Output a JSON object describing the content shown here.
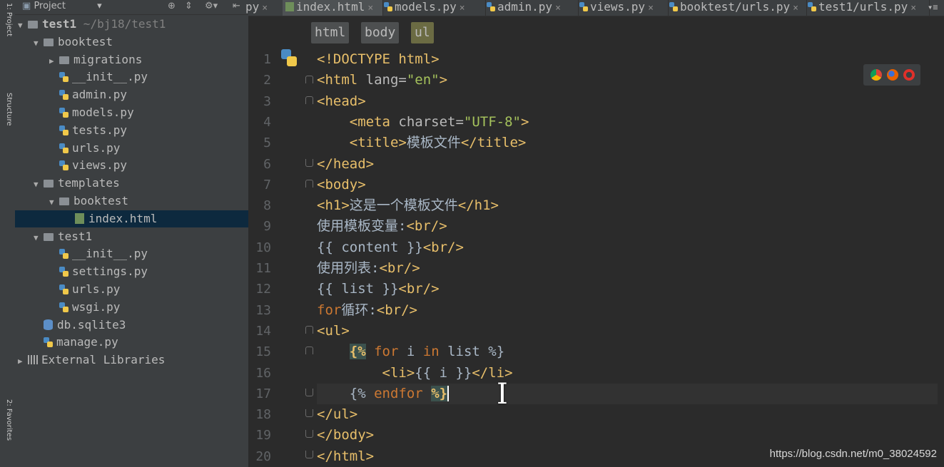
{
  "toolstrip": {
    "top_label": "1: Project",
    "mid_label": "Structure",
    "bottom_label": "2: Favorites"
  },
  "project_panel": {
    "title": "Project",
    "tree": [
      {
        "label": "test1",
        "extra": " ~/bj18/test1",
        "type": "root",
        "depth": 0,
        "arrow": "▼"
      },
      {
        "label": "booktest",
        "type": "folder",
        "depth": 1,
        "arrow": "▼"
      },
      {
        "label": "migrations",
        "type": "folder",
        "depth": 2,
        "arrow": "▶"
      },
      {
        "label": "__init__.py",
        "type": "py",
        "depth": 2
      },
      {
        "label": "admin.py",
        "type": "py",
        "depth": 2
      },
      {
        "label": "models.py",
        "type": "py",
        "depth": 2
      },
      {
        "label": "tests.py",
        "type": "py",
        "depth": 2
      },
      {
        "label": "urls.py",
        "type": "py",
        "depth": 2
      },
      {
        "label": "views.py",
        "type": "py",
        "depth": 2
      },
      {
        "label": "templates",
        "type": "folder",
        "depth": 1,
        "arrow": "▼"
      },
      {
        "label": "booktest",
        "type": "folder",
        "depth": 2,
        "arrow": "▼"
      },
      {
        "label": "index.html",
        "type": "html",
        "depth": 3,
        "selected": true
      },
      {
        "label": "test1",
        "type": "folder",
        "depth": 1,
        "arrow": "▼"
      },
      {
        "label": "__init__.py",
        "type": "py",
        "depth": 2
      },
      {
        "label": "settings.py",
        "type": "py",
        "depth": 2
      },
      {
        "label": "urls.py",
        "type": "py",
        "depth": 2
      },
      {
        "label": "wsgi.py",
        "type": "py",
        "depth": 2
      },
      {
        "label": "db.sqlite3",
        "type": "db",
        "depth": 1
      },
      {
        "label": "manage.py",
        "type": "py",
        "depth": 1
      },
      {
        "label": "External Libraries",
        "type": "lib",
        "depth": 0,
        "arrow": "▶"
      }
    ]
  },
  "tabs": [
    {
      "label": "py",
      "type": "py",
      "active": false
    },
    {
      "label": "index.html",
      "type": "html",
      "active": true
    },
    {
      "label": "models.py",
      "type": "py",
      "active": false
    },
    {
      "label": "admin.py",
      "type": "py",
      "active": false
    },
    {
      "label": "views.py",
      "type": "py",
      "active": false
    },
    {
      "label": "booktest/urls.py",
      "type": "py",
      "active": false
    },
    {
      "label": "test1/urls.py",
      "type": "py",
      "active": false
    }
  ],
  "tab_overflow": "▾≡",
  "breadcrumb": [
    "html",
    "body",
    "ul"
  ],
  "editor": {
    "line_numbers": [
      "1",
      "2",
      "3",
      "4",
      "5",
      "6",
      "7",
      "8",
      "9",
      "10",
      "11",
      "12",
      "13",
      "14",
      "15",
      "16",
      "17",
      "18",
      "19",
      "20"
    ],
    "current_line": 17
  },
  "colors": {
    "bg": "#2b2b2b",
    "tag": "#e8bf6a",
    "string": "#a5c25c",
    "keyword": "#cc7832",
    "text": "#a9b7c6",
    "selection": "#0d293e"
  },
  "watermark": "https://blog.csdn.net/m0_38024592"
}
